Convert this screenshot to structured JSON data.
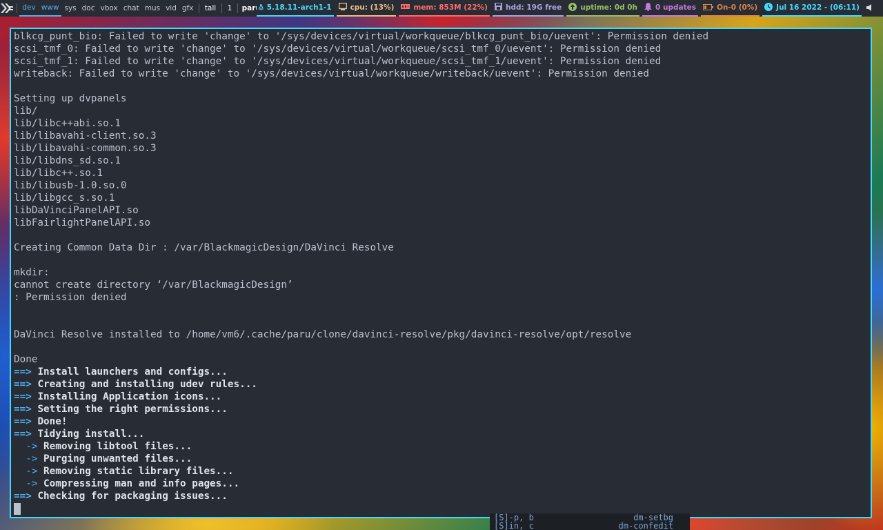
{
  "topbar": {
    "workspaces": [
      "dev",
      "www",
      "sys",
      "doc",
      "vbox",
      "chat",
      "mus",
      "vid",
      "gfx"
    ],
    "active_workspaces": [
      0,
      1
    ],
    "layout": "tall",
    "window_count": "1",
    "window_title": "paru -S dav",
    "kernel": "5.18.11-arch1-1",
    "cpu": "cpu: (13%)",
    "mem": "mem: 853M (22%)",
    "hdd": "hdd: 19G free",
    "uptime": "uptime: 0d 0h",
    "updates": "0 updates",
    "battery": "On-0 (0%)",
    "clock": "Jul 16 2022 - (06:11)",
    "colors": {
      "bar_bg": "#282c34",
      "kernel": "#46d9ff",
      "cpu": "#ecbe7b",
      "mem": "#ff6c6b",
      "hdd": "#a9a1e1",
      "uptime": "#98be65",
      "updates": "#c678dd",
      "battery": "#da8548",
      "clock": "#46d9ff"
    },
    "icons": [
      "xmonad-logo",
      "penguin-icon",
      "cpu-icon",
      "memory-icon",
      "disk-icon",
      "uptime-icon",
      "bell-icon",
      "battery-icon",
      "clock-icon",
      "speaker-icon"
    ]
  },
  "terminal": {
    "border_color": "#46d9ff",
    "lines": [
      {
        "t": "plain",
        "text": "blkcg_punt_bio: Failed to write 'change' to '/sys/devices/virtual/workqueue/blkcg_punt_bio/uevent': Permission denied"
      },
      {
        "t": "plain",
        "text": "scsi_tmf_0: Failed to write 'change' to '/sys/devices/virtual/workqueue/scsi_tmf_0/uevent': Permission denied"
      },
      {
        "t": "plain",
        "text": "scsi_tmf_1: Failed to write 'change' to '/sys/devices/virtual/workqueue/scsi_tmf_1/uevent': Permission denied"
      },
      {
        "t": "plain",
        "text": "writeback: Failed to write 'change' to '/sys/devices/virtual/workqueue/writeback/uevent': Permission denied"
      },
      {
        "t": "plain",
        "text": ""
      },
      {
        "t": "plain",
        "text": "Setting up dvpanels"
      },
      {
        "t": "plain",
        "text": "lib/"
      },
      {
        "t": "plain",
        "text": "lib/libc++abi.so.1"
      },
      {
        "t": "plain",
        "text": "lib/libavahi-client.so.3"
      },
      {
        "t": "plain",
        "text": "lib/libavahi-common.so.3"
      },
      {
        "t": "plain",
        "text": "lib/libdns_sd.so.1"
      },
      {
        "t": "plain",
        "text": "lib/libc++.so.1"
      },
      {
        "t": "plain",
        "text": "lib/libusb-1.0.so.0"
      },
      {
        "t": "plain",
        "text": "lib/libgcc_s.so.1"
      },
      {
        "t": "plain",
        "text": "libDaVinciPanelAPI.so"
      },
      {
        "t": "plain",
        "text": "libFairlightPanelAPI.so"
      },
      {
        "t": "plain",
        "text": ""
      },
      {
        "t": "plain",
        "text": "Creating Common Data Dir : /var/BlackmagicDesign/DaVinci Resolve"
      },
      {
        "t": "plain",
        "text": ""
      },
      {
        "t": "plain",
        "text": "mkdir:"
      },
      {
        "t": "plain",
        "text": "cannot create directory ‘/var/BlackmagicDesign’"
      },
      {
        "t": "plain",
        "text": ": Permission denied"
      },
      {
        "t": "plain",
        "text": ""
      },
      {
        "t": "plain",
        "text": ""
      },
      {
        "t": "plain",
        "text": "DaVinci Resolve installed to /home/vm6/.cache/paru/clone/davinci-resolve/pkg/davinci-resolve/opt/resolve"
      },
      {
        "t": "plain",
        "text": ""
      },
      {
        "t": "plain",
        "text": "Done"
      },
      {
        "t": "step",
        "arrow": "==>",
        "text": "Install launchers and configs..."
      },
      {
        "t": "step",
        "arrow": "==>",
        "text": "Creating and installing udev rules..."
      },
      {
        "t": "step",
        "arrow": "==>",
        "text": "Installing Application icons..."
      },
      {
        "t": "step",
        "arrow": "==>",
        "text": "Setting the right permissions..."
      },
      {
        "t": "step",
        "arrow": "==>",
        "text": "Done!"
      },
      {
        "t": "step2",
        "arrow": "==>",
        "text": "Tidying install..."
      },
      {
        "t": "sub",
        "arrow": "  ->",
        "text": "Removing libtool files..."
      },
      {
        "t": "sub",
        "arrow": "  ->",
        "text": "Purging unwanted files..."
      },
      {
        "t": "sub",
        "arrow": "  ->",
        "text": "Removing static library files..."
      },
      {
        "t": "sub",
        "arrow": "  ->",
        "text": "Compressing man and info pages..."
      },
      {
        "t": "step2",
        "arrow": "==>",
        "text": "Checking for packaging issues..."
      }
    ]
  },
  "background_window": {
    "rows": [
      {
        "left": "[S]-p, b",
        "right": "dm-setbg"
      },
      {
        "left": "[S]in, c",
        "right": "dm-confedit"
      }
    ]
  }
}
